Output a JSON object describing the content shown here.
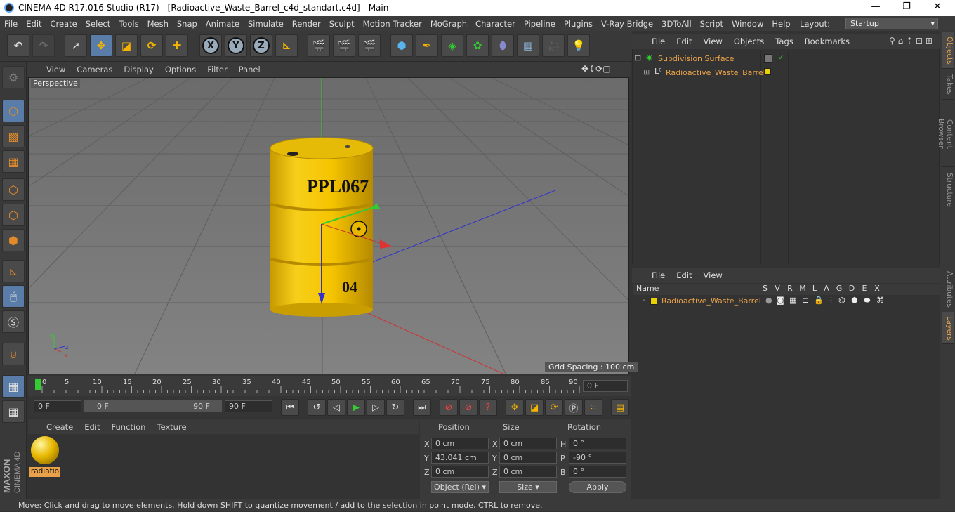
{
  "window": {
    "title": "CINEMA 4D R17.016 Studio (R17) - [Radioactive_Waste_Barrel_c4d_standart.c4d] - Main"
  },
  "menu": [
    "File",
    "Edit",
    "Create",
    "Select",
    "Tools",
    "Mesh",
    "Snap",
    "Animate",
    "Simulate",
    "Render",
    "Sculpt",
    "Motion Tracker",
    "MoGraph",
    "Character",
    "Pipeline",
    "Plugins",
    "V-Ray Bridge",
    "3DToAll",
    "Script",
    "Window",
    "Help"
  ],
  "layout": {
    "label": "Layout:",
    "value": "Startup"
  },
  "viewport": {
    "menu": [
      "View",
      "Cameras",
      "Display",
      "Options",
      "Filter",
      "Panel"
    ],
    "label": "Perspective",
    "grid_spacing": "Grid Spacing : 100 cm",
    "barrel_text_1": "PPL067",
    "barrel_text_2": "04"
  },
  "timeline": {
    "ticks": [
      "0",
      "5",
      "10",
      "15",
      "20",
      "25",
      "30",
      "35",
      "40",
      "45",
      "50",
      "55",
      "60",
      "65",
      "70",
      "75",
      "80",
      "85",
      "90"
    ],
    "current_frame": "0 F"
  },
  "transport": {
    "start": "0 F",
    "range_start": "0 F",
    "range_end": "90 F",
    "end": "90 F"
  },
  "material_manager": {
    "menu": [
      "Create",
      "Edit",
      "Function",
      "Texture"
    ],
    "material_label": "radiatio"
  },
  "coordinates": {
    "headers": {
      "position": "Position",
      "size": "Size",
      "rotation": "Rotation"
    },
    "pos": {
      "x": "0 cm",
      "y": "43.041 cm",
      "z": "0 cm"
    },
    "size": {
      "x": "0 cm",
      "y": "0 cm",
      "z": "0 cm"
    },
    "rot": {
      "h": "0 °",
      "p": "-90 °",
      "b": "0 °"
    },
    "mode": "Object (Rel)",
    "size_mode": "Size",
    "apply": "Apply",
    "axes": [
      "X",
      "Y",
      "Z",
      "H",
      "P",
      "B"
    ]
  },
  "objects_panel": {
    "menu": [
      "File",
      "Edit",
      "View",
      "Objects",
      "Tags",
      "Bookmarks"
    ],
    "items": [
      "Subdivision Surface",
      "Radioactive_Waste_Barrel"
    ]
  },
  "layers_panel": {
    "menu": [
      "File",
      "Edit",
      "View"
    ],
    "columns": [
      "Name",
      "S",
      "V",
      "R",
      "M",
      "L",
      "A",
      "G",
      "D",
      "E",
      "X"
    ],
    "row": "Radioactive_Waste_Barrel"
  },
  "side_tabs": [
    "Objects",
    "Takes",
    "Content Browser",
    "Structure",
    "Attributes",
    "Layers"
  ],
  "status": "Move: Click and drag to move elements. Hold down SHIFT to quantize movement / add to the selection in point mode, CTRL to remove.",
  "colors": {
    "accent": "#eaa24a",
    "selected": "#5a7ca8",
    "barrel": "#f5c400"
  }
}
